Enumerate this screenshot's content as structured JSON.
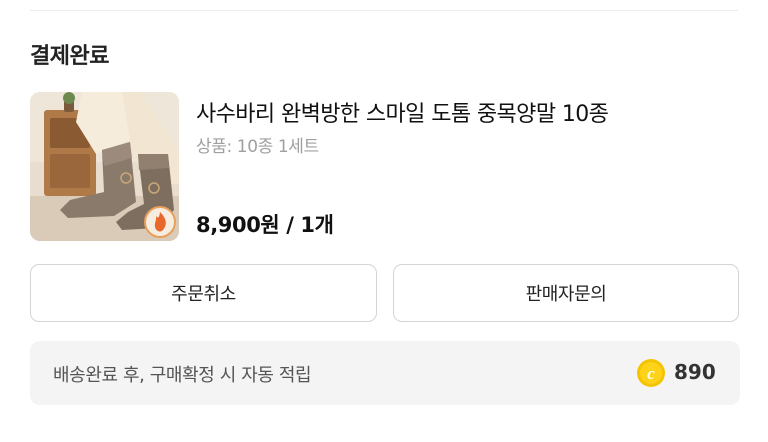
{
  "order": {
    "status": "결제완료"
  },
  "product": {
    "image_alt": "socks-photo",
    "name": "사수바리 완벽방한 스마일 도톰 중목양말 10종",
    "option": "상품: 10종 1세트",
    "price": "8,900원 / 1개"
  },
  "actions": {
    "cancel_label": "주문취소",
    "inquiry_label": "판매자문의"
  },
  "reward": {
    "text": "배송완료 후, 구매확정 시 자동 적립",
    "icon": "coin-icon",
    "icon_color": "#f5c400",
    "amount": "890"
  }
}
